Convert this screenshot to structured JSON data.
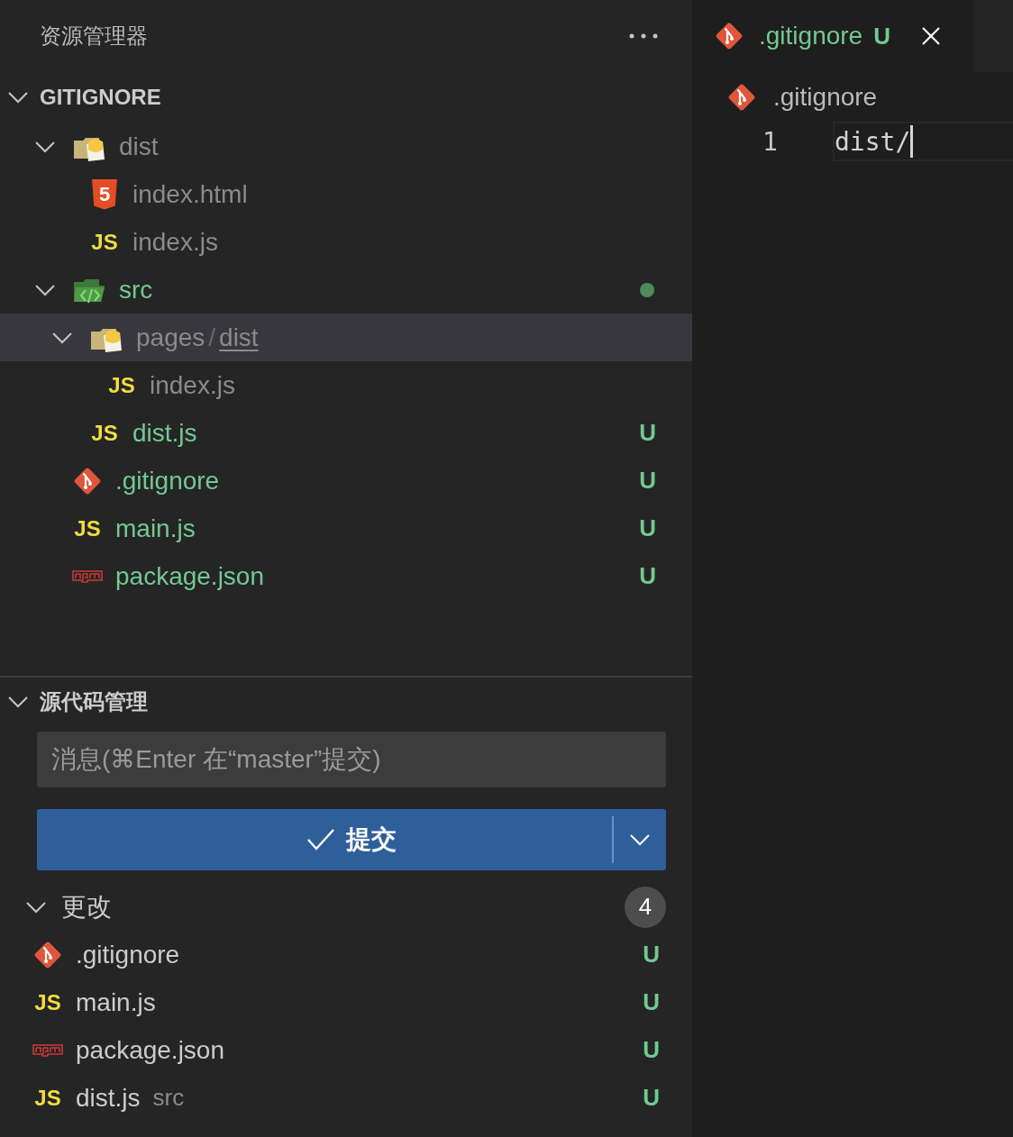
{
  "explorer": {
    "title": "资源管理器",
    "section": {
      "title": "GITIGNORE",
      "expanded": true,
      "items": [
        {
          "kind": "folder",
          "name": "dist",
          "expanded": true,
          "selected": false,
          "ignored": true,
          "children": [
            {
              "kind": "html",
              "badge": "5",
              "name": "index.html",
              "selected": false,
              "ignored": true
            },
            {
              "kind": "js",
              "badge": "JS",
              "name": "index.js",
              "selected": false,
              "ignored": true
            }
          ]
        },
        {
          "kind": "code-folder",
          "name": "src",
          "expanded": true,
          "selected": false,
          "ignored": false,
          "untracked": true,
          "dot": true,
          "children": [
            {
              "kind": "folder",
              "name": "pages",
              "separator": "/",
              "sub_name": "dist",
              "expanded": true,
              "selected": true,
              "ignored": true,
              "children": [
                {
                  "kind": "js",
                  "badge": "JS",
                  "name": "index.js",
                  "selected": false,
                  "ignored": true
                }
              ]
            },
            {
              "kind": "js",
              "badge": "JS",
              "name": "dist.js",
              "status": "U",
              "selected": false,
              "ignored": false,
              "untracked": true
            }
          ]
        },
        {
          "kind": "git",
          "name": ".gitignore",
          "status": "U",
          "selected": false,
          "ignored": false,
          "untracked": true
        },
        {
          "kind": "js",
          "badge": "JS",
          "name": "main.js",
          "status": "U",
          "selected": false,
          "ignored": false,
          "untracked": true
        },
        {
          "kind": "npm",
          "name": "package.json",
          "status": "U",
          "selected": false,
          "ignored": false,
          "untracked": true
        }
      ]
    }
  },
  "source_control": {
    "title": "源代码管理",
    "expanded": true,
    "message": {
      "placeholder": "消息(⌘Enter 在“master”提交)"
    },
    "commit_button": {
      "label": "提交"
    },
    "changes": {
      "title": "更改",
      "count": "4",
      "expanded": true,
      "items": [
        {
          "kind": "git",
          "name": ".gitignore",
          "status": "U"
        },
        {
          "kind": "js",
          "badge": "JS",
          "name": "main.js",
          "status": "U"
        },
        {
          "kind": "npm",
          "name": "package.json",
          "status": "U"
        },
        {
          "kind": "js",
          "badge": "JS",
          "name": "dist.js",
          "folder": "src",
          "status": "U"
        }
      ]
    }
  },
  "editor": {
    "tabs": [
      {
        "kind": "git",
        "name": ".gitignore",
        "status": "U",
        "selected": true,
        "untracked": true
      }
    ],
    "breadcrumb": [
      {
        "kind": "git",
        "name": ".gitignore"
      }
    ],
    "lines": [
      {
        "number": "1",
        "text": "dist/"
      }
    ]
  }
}
